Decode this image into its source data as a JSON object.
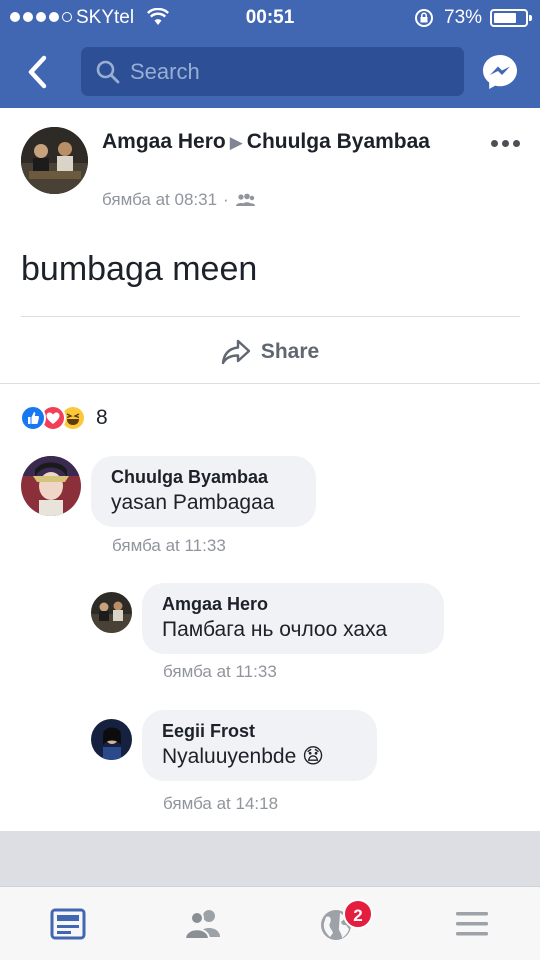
{
  "status_bar": {
    "carrier": "SKYtel",
    "time": "00:51",
    "battery": "73%",
    "battery_level": 0.73,
    "signal_bars": 4
  },
  "header": {
    "search_placeholder": "Search",
    "back_icon": "chevron-left-icon",
    "messenger_icon": "messenger-icon"
  },
  "post": {
    "author": "Amgaa Hero",
    "target": "Chuulga Byambaa",
    "timestamp": "бямба at 08:31",
    "audience_icon": "friends-icon",
    "text": "bumbaga meen",
    "share_label": "Share",
    "reactions": [
      "like",
      "love",
      "haha"
    ],
    "reaction_count": "8"
  },
  "comments": [
    {
      "author": "Chuulga Byambaa",
      "text": "yasan Pambagaa",
      "time": "бямба at 11:33"
    },
    {
      "author": "Amgaa Hero",
      "text": "Памбага нь очлоо хаха",
      "time": "бямба at 11:33"
    },
    {
      "author": "Eegii Frost",
      "text": "Nyaluuyenbde",
      "emoji": "😧",
      "time": "бямба at 14:18"
    }
  ],
  "tabbar": {
    "items": [
      "news-feed-icon",
      "friends-icon",
      "notifications-globe-icon",
      "menu-icon"
    ],
    "notification_badge": "2",
    "active_color": "#4267b2"
  },
  "colors": {
    "brand": "#4267b2",
    "search_bg": "#2d4f96",
    "badge": "#e41e3f"
  }
}
